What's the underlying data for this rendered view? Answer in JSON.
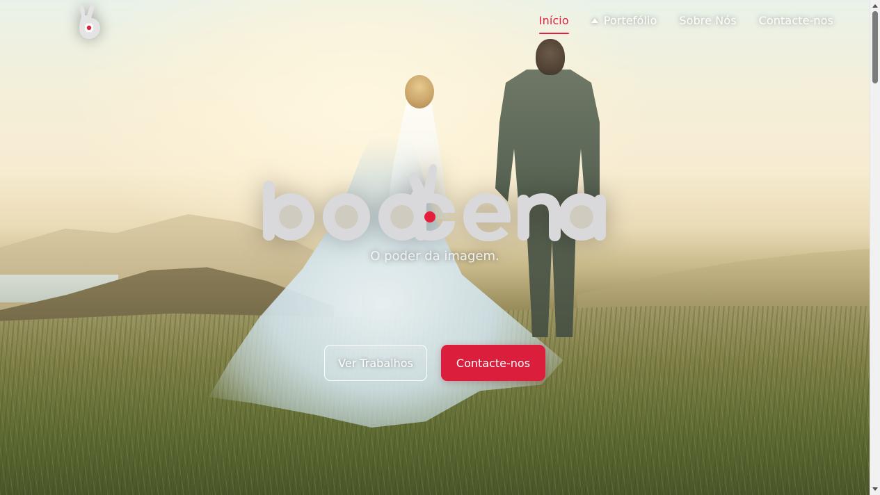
{
  "brand": {
    "logo_icon": "hand-gesture-logo-icon",
    "wordmark": "boacena",
    "accent_color": "#e31f3c",
    "logo_color": "#dcdcdc"
  },
  "nav": {
    "items": [
      {
        "label": "Início",
        "active": true
      },
      {
        "label": "Portefólio",
        "icon": "caret-up-icon"
      },
      {
        "label": "Sobre Nós"
      },
      {
        "label": "Contacte-nos"
      }
    ]
  },
  "hero": {
    "tagline": "O poder da imagem.",
    "buttons": {
      "secondary": "Ver Trabalhos",
      "primary": "Contacte-nos"
    }
  }
}
